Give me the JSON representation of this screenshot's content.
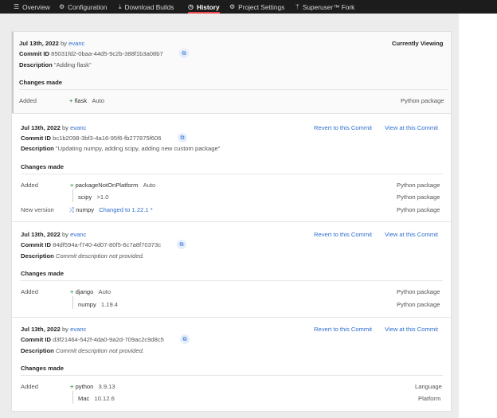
{
  "nav": {
    "tabs": [
      {
        "label": "Overview",
        "icon": "hamburger-icon"
      },
      {
        "label": "Configuration",
        "icon": "gear-icon"
      },
      {
        "label": "Download Builds",
        "icon": "download-icon"
      },
      {
        "label": "History",
        "icon": "history-icon",
        "active": true
      },
      {
        "label": "Project Settings",
        "icon": "gear-icon"
      },
      {
        "label": "Superuser™ Fork",
        "icon": "fork-icon"
      }
    ]
  },
  "labels": {
    "by": "by",
    "commit_id": "Commit ID",
    "description": "Description",
    "changes_made": "Changes made",
    "currently_viewing": "Currently Viewing",
    "revert": "Revert to this Commit",
    "view": "View at this Commit"
  },
  "commits": [
    {
      "date": "Jul 13th, 2022",
      "author": "evanc",
      "commit_id": "85031fd2-0baa-44d5-9c2b-388f1b3a08b7",
      "description": "\"Adding flask\"",
      "changes": [
        {
          "type": "Added",
          "name": "flask",
          "version": "Auto",
          "kind": "Python package"
        }
      ]
    },
    {
      "date": "Jul 13th, 2022",
      "author": "evanc",
      "commit_id": "bc1b2098-3bf3-4a16-95f6-fb277875f606",
      "description": "\"Updating numpy, adding scipy, adding new custom package\"",
      "changes": [
        {
          "type": "Added",
          "name": "packageNotOnPlatform",
          "version": "Auto",
          "kind": "Python package"
        },
        {
          "type": "",
          "name": "scipy",
          "version": ">1.0",
          "kind": "Python package"
        },
        {
          "type": "New version",
          "name": "numpy",
          "version": "Changed to 1.22.1",
          "kind": "Python package"
        }
      ]
    },
    {
      "date": "Jul 13th, 2022",
      "author": "evanc",
      "commit_id": "84df594a-f740-4d07-80f5-6c7a8f70373c",
      "description": "Commit description not provided.",
      "changes": [
        {
          "type": "Added",
          "name": "django",
          "version": "Auto",
          "kind": "Python package"
        },
        {
          "type": "",
          "name": "numpy",
          "version": "1.19.4",
          "kind": "Python package"
        }
      ]
    },
    {
      "date": "Jul 13th, 2022",
      "author": "evanc",
      "commit_id": "d3f21464-542f-4da0-9a2d-709ac2c9d8c5",
      "description": "Commit description not provided.",
      "changes": [
        {
          "type": "Added",
          "name": "python",
          "version": "3.9.13",
          "kind": "Language"
        },
        {
          "type": "",
          "name": "Mac",
          "version": "10.12.6",
          "kind": "Platform"
        }
      ]
    }
  ]
}
